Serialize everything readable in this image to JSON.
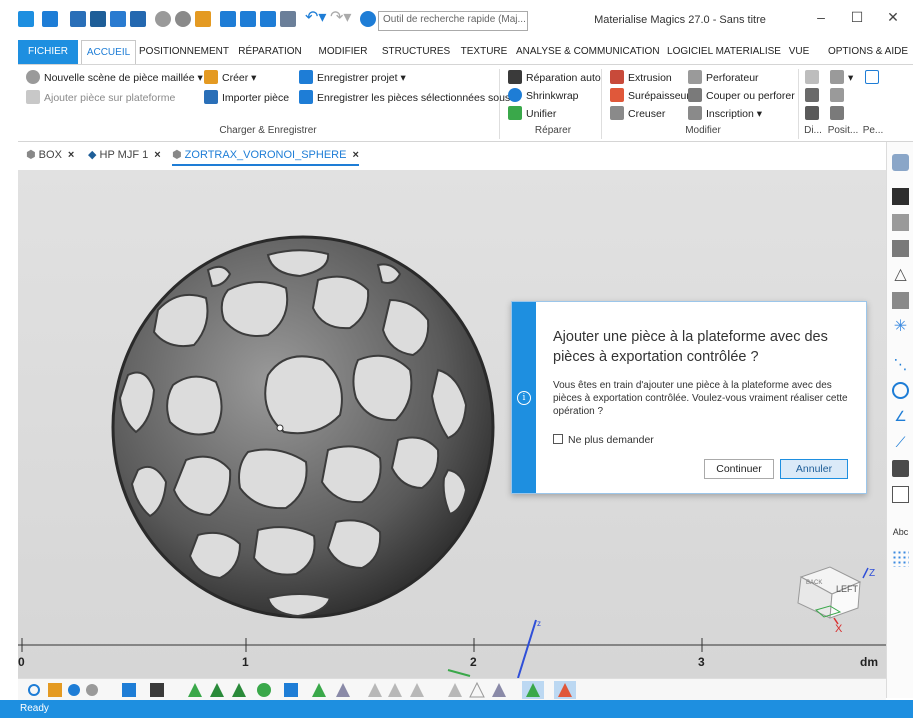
{
  "window": {
    "title": "Materialise Magics 27.0 - Sans titre",
    "search_placeholder": "Outil de recherche rapide (Maj...",
    "minimize": "–",
    "maximize": "☐",
    "close": "✕"
  },
  "ribbon_tabs": [
    "FICHIER",
    "ACCUEIL",
    "POSITIONNEMENT",
    "RÉPARATION",
    "MODIFIER",
    "STRUCTURES",
    "TEXTURE",
    "ANALYSE & COMMUNICATION",
    "LOGICIEL MATERIALISE",
    "VUE",
    "OPTIONS & AIDE"
  ],
  "ribbon": {
    "new_scene": "Nouvelle scène de pièce maillée",
    "add_to_platform": "Ajouter pièce sur plateforme",
    "create": "Créer",
    "import": "Importer pièce",
    "save_project": "Enregistrer projet",
    "save_selected": "Enregistrer les pièces sélectionnées sous",
    "group_load_save": "Charger & Enregistrer",
    "auto_repair": "Réparation auto",
    "shrinkwrap": "Shrinkwrap",
    "unify": "Unifier",
    "group_repair": "Réparer",
    "extrusion": "Extrusion",
    "thicken": "Surépaisseur",
    "hollow": "Creuser",
    "perforator": "Perforateur",
    "cut_punch": "Couper ou perforer",
    "inscription": "Inscription",
    "group_modify": "Modifier",
    "group_di": "Di...",
    "group_posit": "Posit...",
    "group_pe": "Pe..."
  },
  "doc_tabs": [
    "BOX",
    "HP MJF 1",
    "ZORTRAX_VORONOI_SPHERE"
  ],
  "ruler": {
    "labels": [
      "0",
      "1",
      "2",
      "3"
    ],
    "unit": "dm"
  },
  "axis_labels": {
    "z": "z",
    "cube_left": "LEFT",
    "cube_back": "BACK",
    "cube_z": "Z",
    "cube_x": "X"
  },
  "dialog": {
    "title": "Ajouter une pièce à la plateforme avec des pièces à exportation contrôlée ?",
    "message": "Vous êtes en train d'ajouter une pièce à la plateforme avec des pièces à exportation contrôlée. Voulez-vous vraiment réaliser cette opération ?",
    "checkbox_label": "Ne plus demander",
    "continue_label": "Continuer",
    "cancel_label": "Annuler",
    "info_glyph": "i"
  },
  "status": {
    "text": "Ready"
  },
  "colors": {
    "accent": "#1e8fe0",
    "viewport": "#dcdcdc",
    "mesh": "#4a4a4a"
  }
}
